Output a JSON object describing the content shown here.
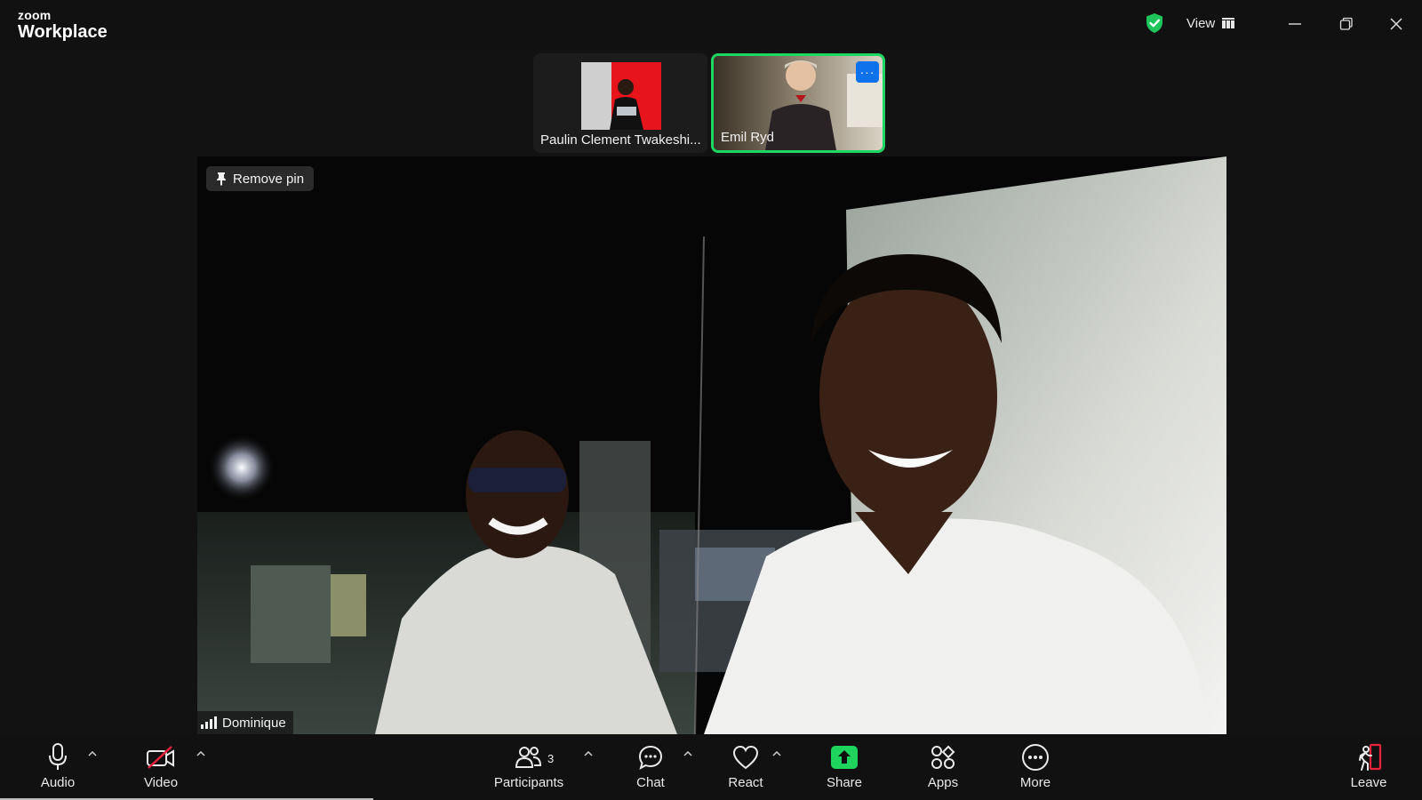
{
  "app": {
    "logo_small": "zoom",
    "logo_large": "Workplace"
  },
  "titlebar": {
    "view_label": "View"
  },
  "thumbnails": [
    {
      "name": "Paulin Clement Twakeshi...",
      "active": false
    },
    {
      "name": "Emil Ryd",
      "active": true,
      "more_label": "···"
    }
  ],
  "main": {
    "remove_pin_label": "Remove pin",
    "speaker_name": "Dominique"
  },
  "toolbar": {
    "audio": "Audio",
    "video": "Video",
    "participants": "Participants",
    "participants_count": "3",
    "chat": "Chat",
    "react": "React",
    "share": "Share",
    "apps": "Apps",
    "more": "More",
    "leave": "Leave"
  },
  "colors": {
    "accent_green": "#1ed760",
    "share_green": "#1fd45c",
    "leave_red": "#e5243b",
    "active_blue": "#0e72ed"
  }
}
